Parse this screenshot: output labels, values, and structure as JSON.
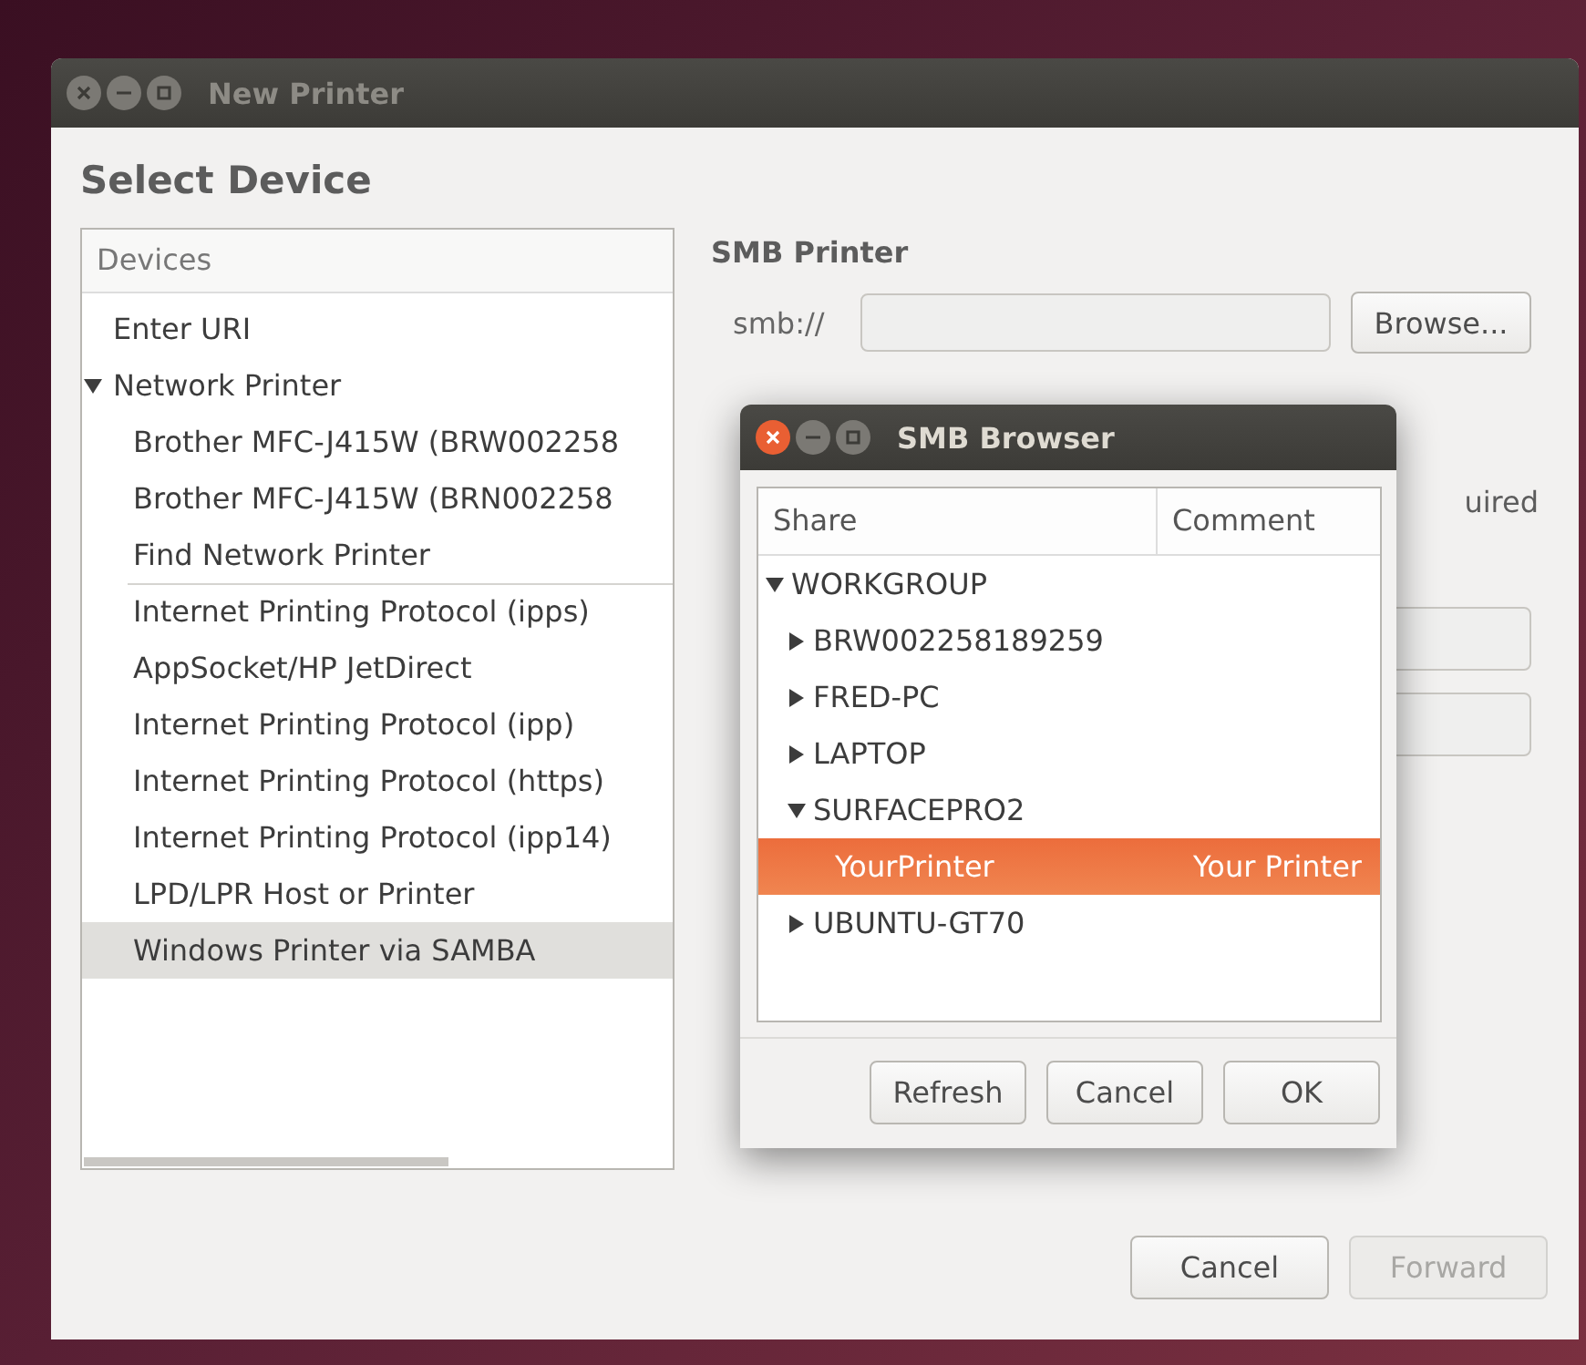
{
  "window": {
    "title": "New Printer",
    "focused": false,
    "heading": "Select Device"
  },
  "devices": {
    "header": "Devices",
    "items": [
      {
        "label": "Enter URI",
        "selected": false
      },
      {
        "label": "Network Printer",
        "selected": false,
        "expanded": true,
        "children": [
          {
            "label": "Brother MFC-J415W (BRW002258",
            "selected": false
          },
          {
            "label": "Brother MFC-J415W (BRN002258",
            "selected": false
          },
          {
            "label": "Find Network Printer",
            "selected": false
          },
          {
            "kind": "separator"
          },
          {
            "label": "Internet Printing Protocol (ipps)",
            "selected": false
          },
          {
            "label": "AppSocket/HP JetDirect",
            "selected": false
          },
          {
            "label": "Internet Printing Protocol (ipp)",
            "selected": false
          },
          {
            "label": "Internet Printing Protocol (https)",
            "selected": false
          },
          {
            "label": "Internet Printing Protocol (ipp14)",
            "selected": false
          },
          {
            "label": "LPD/LPR Host or Printer",
            "selected": false
          },
          {
            "label": "Windows Printer via SAMBA",
            "selected": true
          }
        ]
      }
    ]
  },
  "smb_printer": {
    "title": "SMB Printer",
    "prefix": "smb://",
    "browse_button": "Browse...",
    "partial_label": "uired"
  },
  "smb_browser": {
    "title": "SMB Browser",
    "focused": true,
    "columns": [
      "Share",
      "Comment"
    ],
    "tree": [
      {
        "share": "WORKGROUP",
        "selected": false,
        "expanded": true,
        "children": [
          {
            "share": "BRW002258189259",
            "selected": false,
            "expanded": false
          },
          {
            "share": "FRED-PC",
            "selected": false,
            "expanded": false
          },
          {
            "share": "LAPTOP",
            "selected": false,
            "expanded": false
          },
          {
            "share": "SURFACEPRO2",
            "selected": false,
            "expanded": true,
            "children": [
              {
                "share": "YourPrinter",
                "comment": "Your Printer",
                "selected": true
              }
            ]
          },
          {
            "share": "UBUNTU-GT70",
            "selected": false,
            "expanded": false
          }
        ]
      }
    ],
    "buttons": [
      "Refresh",
      "Cancel",
      "OK"
    ]
  },
  "buttons": [
    {
      "label": "Cancel",
      "disabled": false
    },
    {
      "label": "Forward",
      "disabled": true
    }
  ]
}
